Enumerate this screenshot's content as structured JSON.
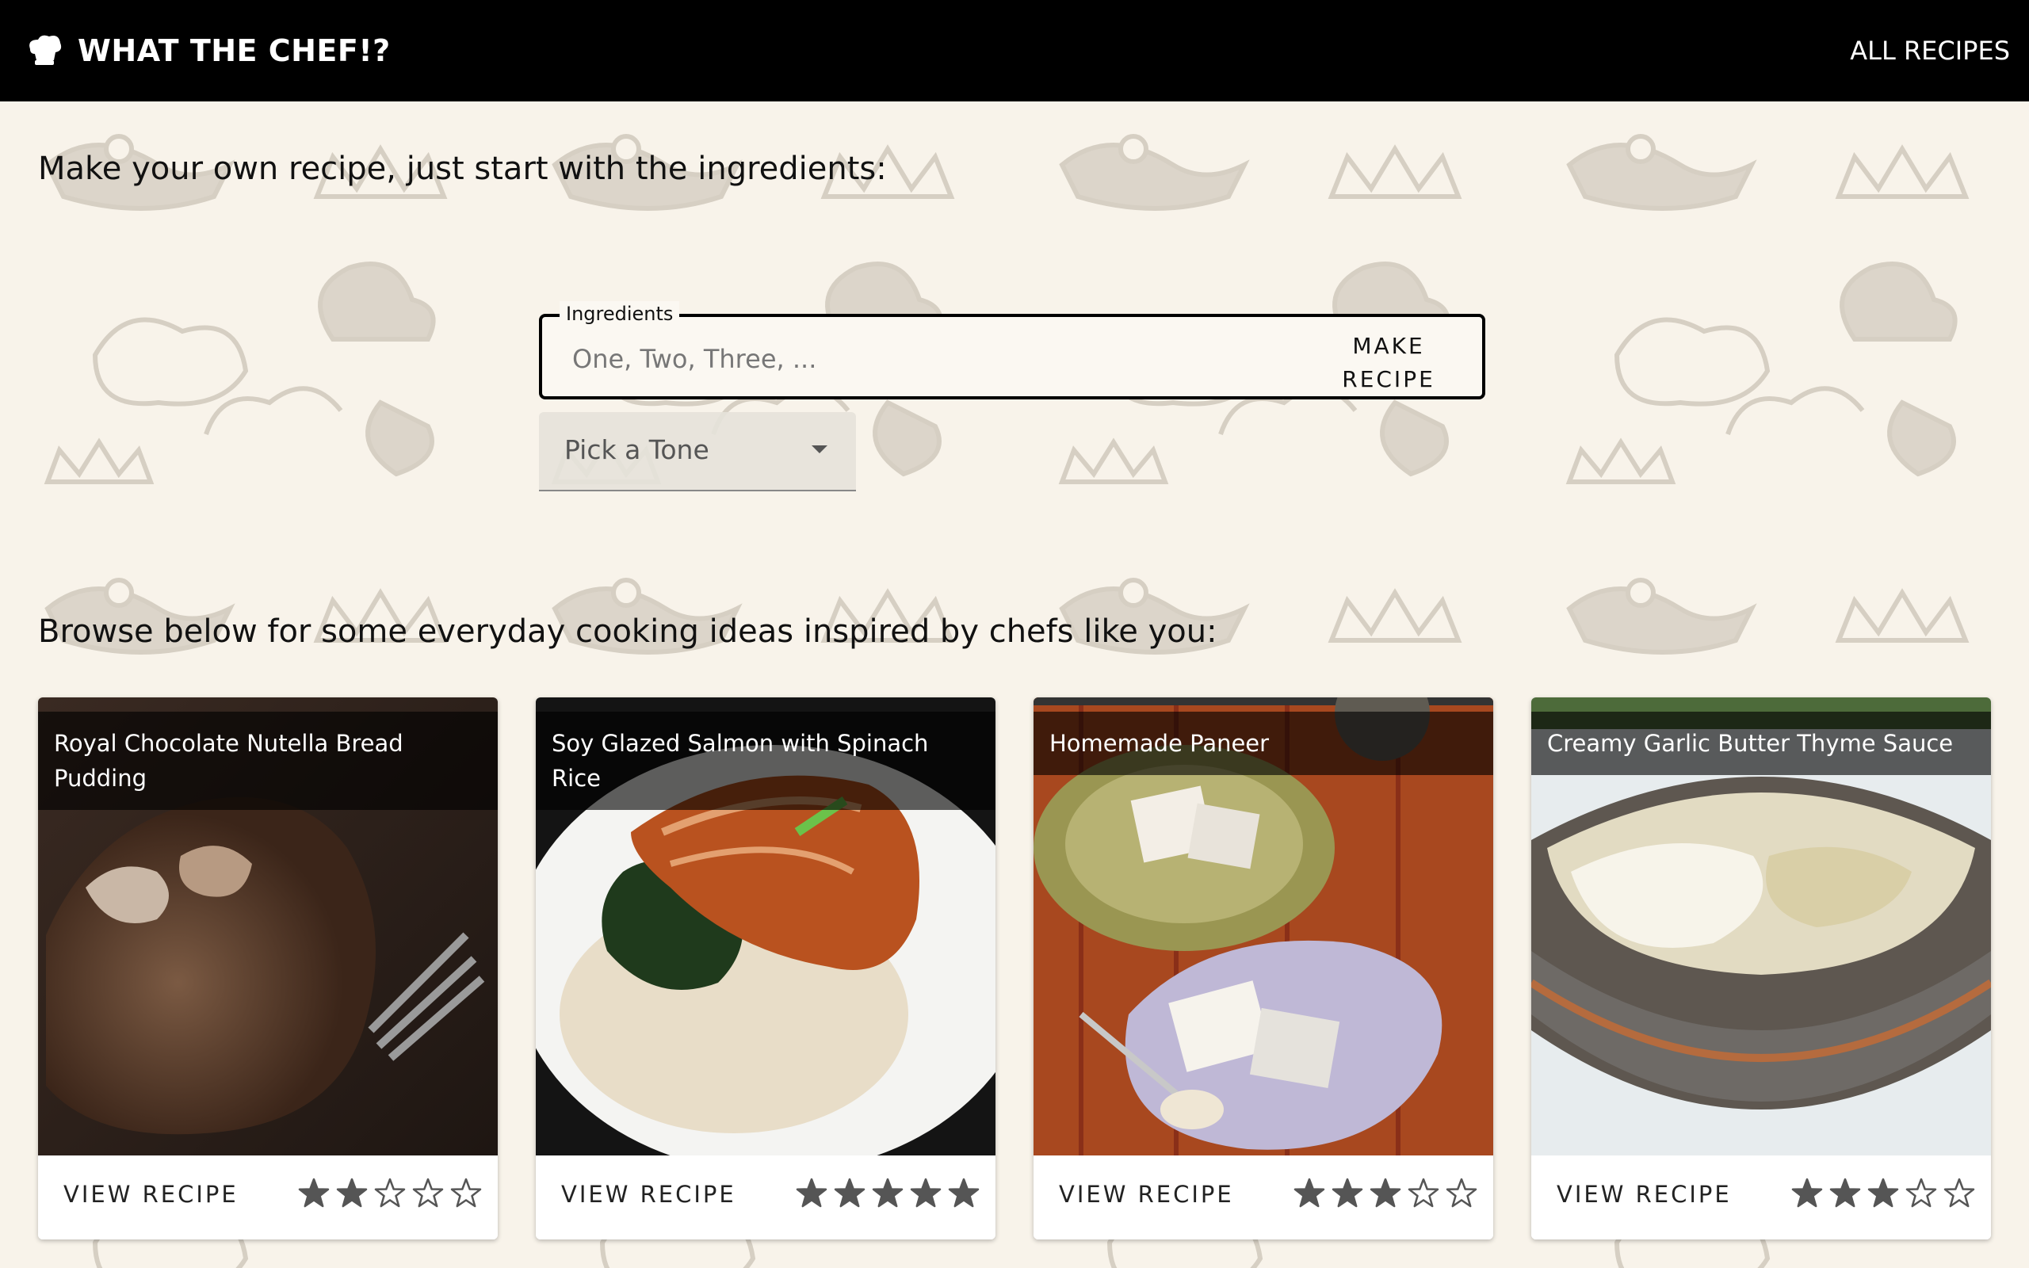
{
  "header": {
    "title": "WHAT THE CHEF!?",
    "all_recipes": "ALL RECIPES"
  },
  "intro": "Make your own recipe, just start with the ingredients:",
  "ingredients": {
    "label": "Ingredients",
    "placeholder": "One, Two, Three, ...",
    "value": "",
    "make_button": "MAKE RECIPE"
  },
  "tone": {
    "placeholder": "Pick a Tone"
  },
  "browse": "Browse below for some everyday cooking ideas inspired by chefs like you:",
  "cards": [
    {
      "title": "Royal Chocolate Nutella Bread Pudding",
      "button": "VIEW RECIPE",
      "rating": 2,
      "max_rating": 5
    },
    {
      "title": "Soy Glazed Salmon with Spinach Rice",
      "button": "VIEW RECIPE",
      "rating": 5,
      "max_rating": 5
    },
    {
      "title": "Homemade Paneer",
      "button": "VIEW RECIPE",
      "rating": 3,
      "max_rating": 5
    },
    {
      "title": "Creamy Garlic Butter Thyme Sauce",
      "button": "VIEW RECIPE",
      "rating": 3,
      "max_rating": 5
    }
  ],
  "colors": {
    "header_bg": "#000000",
    "page_bg": "#f8f3ea",
    "pattern": "#d9d3c8",
    "star": "#555555"
  }
}
